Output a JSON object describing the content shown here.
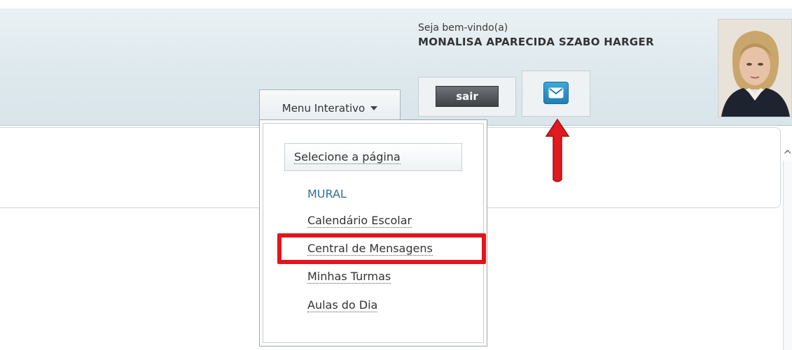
{
  "header": {
    "welcome": "Seja bem-vindo(a)",
    "username": "MONALISA APARECIDA SZABO HARGER",
    "logout_label": "sair",
    "menu_label": "Menu Interativo"
  },
  "dropdown": {
    "select_label": "Selecione a página",
    "items": [
      "MURAL",
      "Calendário Escolar",
      "Central de Mensagens",
      "Minhas Turmas",
      "Aulas do Dia"
    ]
  },
  "icons": {
    "messages": "envelope-icon",
    "menu_caret": "chevron-down-icon"
  },
  "colors": {
    "highlight": "#e4141b",
    "link": "#2f6e9e",
    "mail_button": "#2a93c8"
  }
}
